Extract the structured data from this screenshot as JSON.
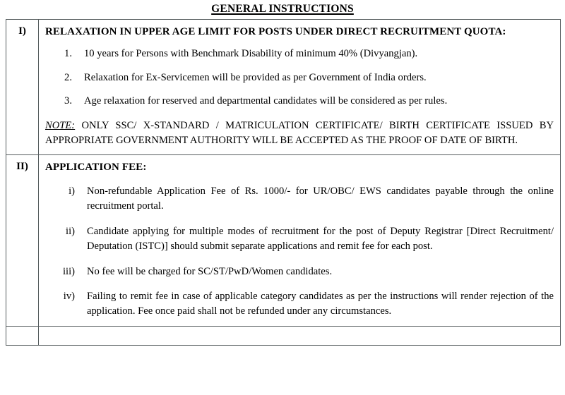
{
  "document": {
    "title": "GENERAL INSTRUCTIONS"
  },
  "sections": [
    {
      "number": "I)",
      "heading": "RELAXATION IN UPPER AGE LIMIT FOR POSTS UNDER DIRECT RECRUITMENT QUOTA:",
      "list_style": "decimal",
      "items": [
        {
          "marker": "1.",
          "text": "10 years for Persons with Benchmark Disability of minimum 40% (Divyangjan)."
        },
        {
          "marker": "2.",
          "text": "Relaxation for Ex-Servicemen will be provided as per Government of India orders."
        },
        {
          "marker": "3.",
          "text": "Age relaxation for reserved and departmental candidates will be considered as per rules."
        }
      ],
      "note": {
        "label": "NOTE:",
        "text": " ONLY SSC/ X-STANDARD / MATRICULATION CERTIFICATE/ BIRTH CERTIFICATE ISSUED BY APPROPRIATE GOVERNMENT AUTHORITY WILL BE ACCEPTED AS THE PROOF OF DATE OF BIRTH."
      }
    },
    {
      "number": "II)",
      "heading": "APPLICATION FEE:",
      "list_style": "lower-roman",
      "items": [
        {
          "marker": "i)",
          "text": "Non-refundable Application Fee of Rs. 1000/- for UR/OBC/ EWS candidates payable through the online recruitment portal."
        },
        {
          "marker": "ii)",
          "text": "Candidate applying for multiple modes of recruitment for the post of Deputy Registrar [Direct Recruitment/ Deputation (ISTC)] should submit separate applications and remit fee for each post."
        },
        {
          "marker": "iii)",
          "text": "No fee will be charged for SC/ST/PwD/Women candidates."
        },
        {
          "marker": "iv)",
          "text": "Failing to remit fee in case of applicable category candidates as per the instructions will render rejection of the application. Fee once paid shall not be refunded under any circumstances."
        }
      ],
      "note": null
    }
  ],
  "colors": {
    "text": "#000000",
    "border": "#555c5e",
    "background": "#ffffff"
  }
}
